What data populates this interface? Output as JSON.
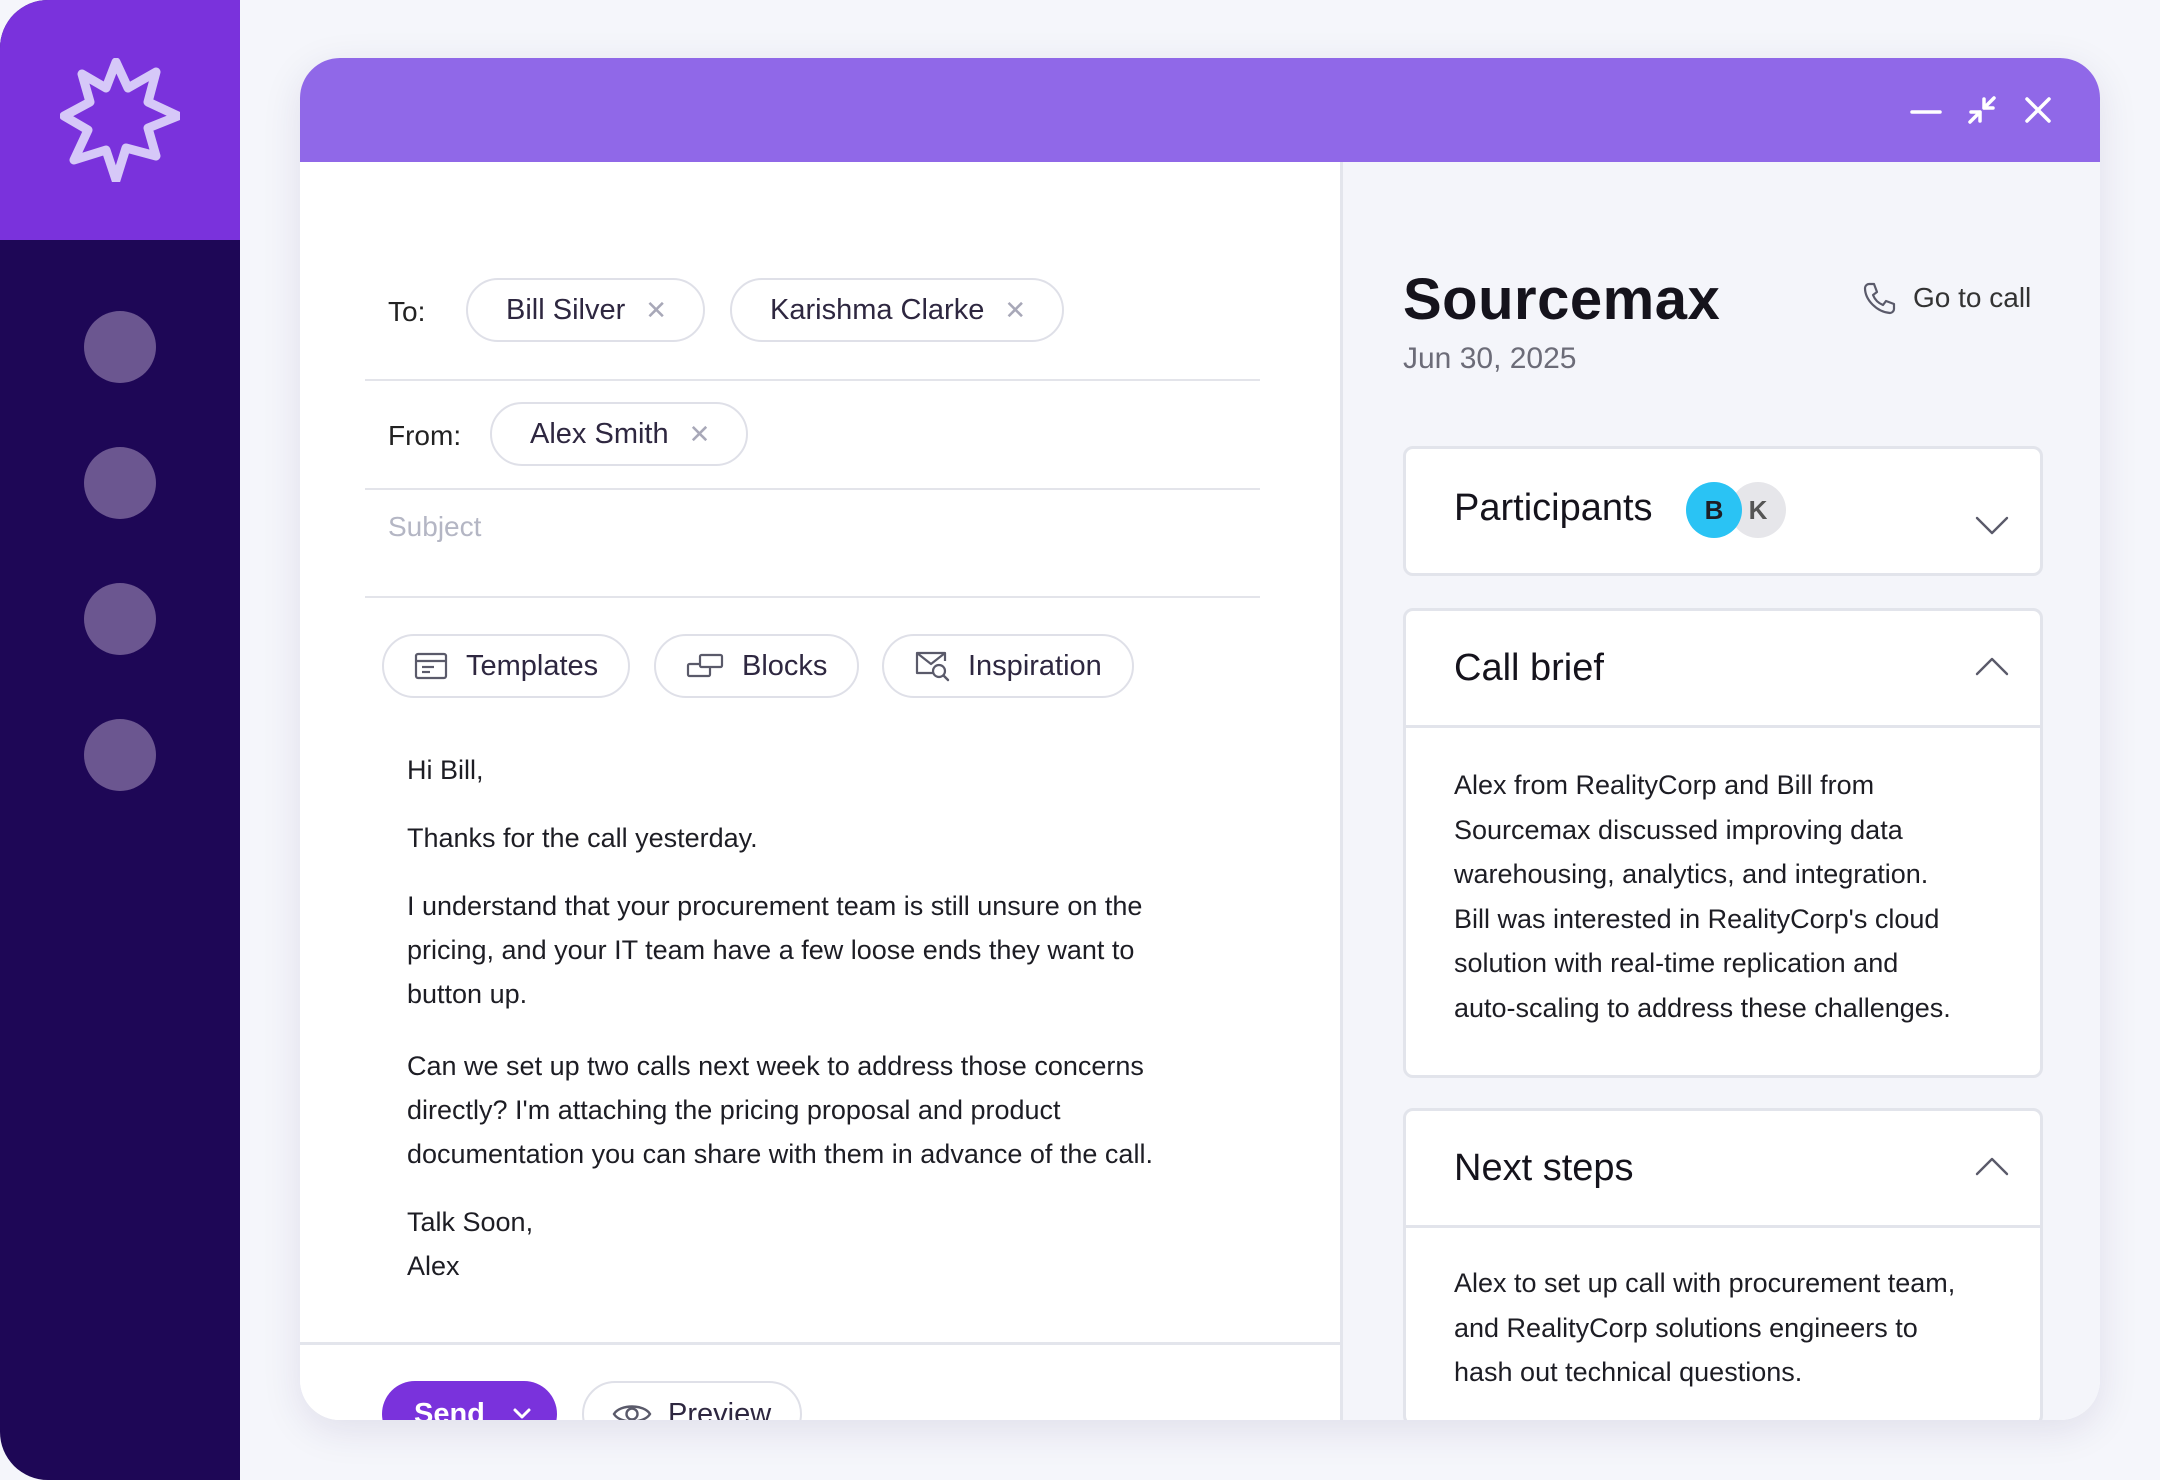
{
  "compose": {
    "to_label": "To:",
    "from_label": "From:",
    "recipients": [
      "Bill Silver",
      "Karishma Clarke"
    ],
    "sender": "Alex Smith",
    "subject_placeholder": "Subject",
    "tools": [
      "Templates",
      "Blocks",
      "Inspiration"
    ],
    "body": {
      "greeting": "Hi Bill,",
      "p1": "Thanks for the call yesterday.",
      "p2_lines": [
        "I understand that your procurement team is still unsure on the",
        "pricing, and your IT team have a few loose ends they want to",
        "button up."
      ],
      "p3_lines": [
        "Can we set up two calls next week to address those concerns",
        "directly? I'm attaching the pricing proposal and product",
        "documentation you can share with them in advance of the call."
      ],
      "signoff": "Talk Soon,",
      "signature": "Alex"
    },
    "send_label": "Send",
    "preview_label": "Preview"
  },
  "side": {
    "title": "Sourcemax",
    "date": "Jun 30, 2025",
    "go_to_call": "Go to call",
    "participants": {
      "heading": "Participants",
      "avatars": [
        "B",
        "K"
      ]
    },
    "call_brief": {
      "heading": "Call brief",
      "lines": [
        "Alex from RealityCorp and Bill from",
        "Sourcemax discussed improving data",
        "warehousing, analytics, and integration.",
        "Bill was interested in RealityCorp's cloud",
        "solution with real-time replication and",
        "auto-scaling to address these challenges."
      ]
    },
    "next_steps": {
      "heading": "Next steps",
      "lines": [
        "Alex to set up call with procurement team,",
        "and RealityCorp solutions engineers to",
        "hash out technical questions."
      ]
    }
  },
  "colors": {
    "rail": "#1e0756",
    "brand": "#7a32dc",
    "titlebar": "#9068e8",
    "avatar_b": "#2ac3f4",
    "avatar_k": "#e6e6ea"
  }
}
